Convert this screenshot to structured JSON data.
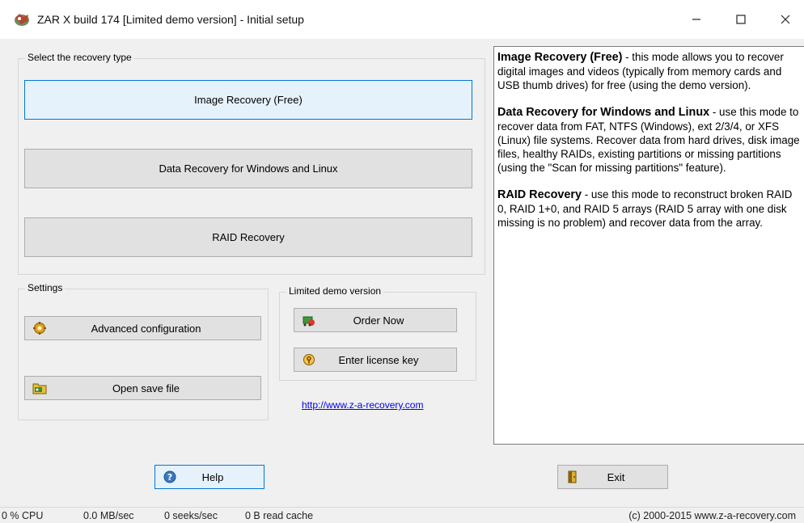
{
  "window": {
    "title": "ZAR X build 174 [Limited demo version] - Initial setup"
  },
  "recovery_group": {
    "title": "Select the recovery type",
    "buttons": {
      "image": "Image Recovery (Free)",
      "data": "Data Recovery for Windows and Linux",
      "raid": "RAID Recovery"
    },
    "selected": "image"
  },
  "settings_group": {
    "title": "Settings",
    "advanced": "Advanced configuration",
    "open_save": "Open save file"
  },
  "demo_group": {
    "title": "Limited demo version",
    "order": "Order Now",
    "license": "Enter license key",
    "url": "http://www.z-a-recovery.com"
  },
  "info": {
    "image_title": "Image Recovery (Free)",
    "image_text": " - this mode allows you to recover digital images and videos (typically from memory cards and USB thumb drives) for free (using the demo version).",
    "data_title": "Data Recovery for Windows and Linux",
    "data_text": " - use this mode to recover data from FAT, NTFS (Windows), ext 2/3/4, or XFS (Linux) file systems. Recover data from hard drives, disk image files, healthy RAIDs, existing partitions or missing partitions (using the \"Scan for missing partitions\" feature).",
    "raid_title": "RAID Recovery",
    "raid_text": " - use this mode to reconstruct broken RAID 0, RAID 1+0, and RAID 5 arrays (RAID 5 array with one disk missing is no problem) and recover data from the array."
  },
  "footer": {
    "help": "Help",
    "exit": "Exit"
  },
  "status": {
    "cpu": "0 % CPU",
    "speed": "0.0 MB/sec",
    "seeks": "0 seeks/sec",
    "cache": "0 B read cache",
    "copyright": "(c) 2000-2015 www.z-a-recovery.com"
  },
  "icons": {
    "app": "zar-app-icon",
    "advanced": "gear-icon",
    "open": "folder-icon",
    "order": "cart-icon",
    "license": "key-icon",
    "help": "help-icon",
    "exit": "exit-door-icon"
  },
  "colors": {
    "accent": "#0078d7",
    "selected_bg": "#e5f1fb",
    "link": "#0000ee"
  }
}
